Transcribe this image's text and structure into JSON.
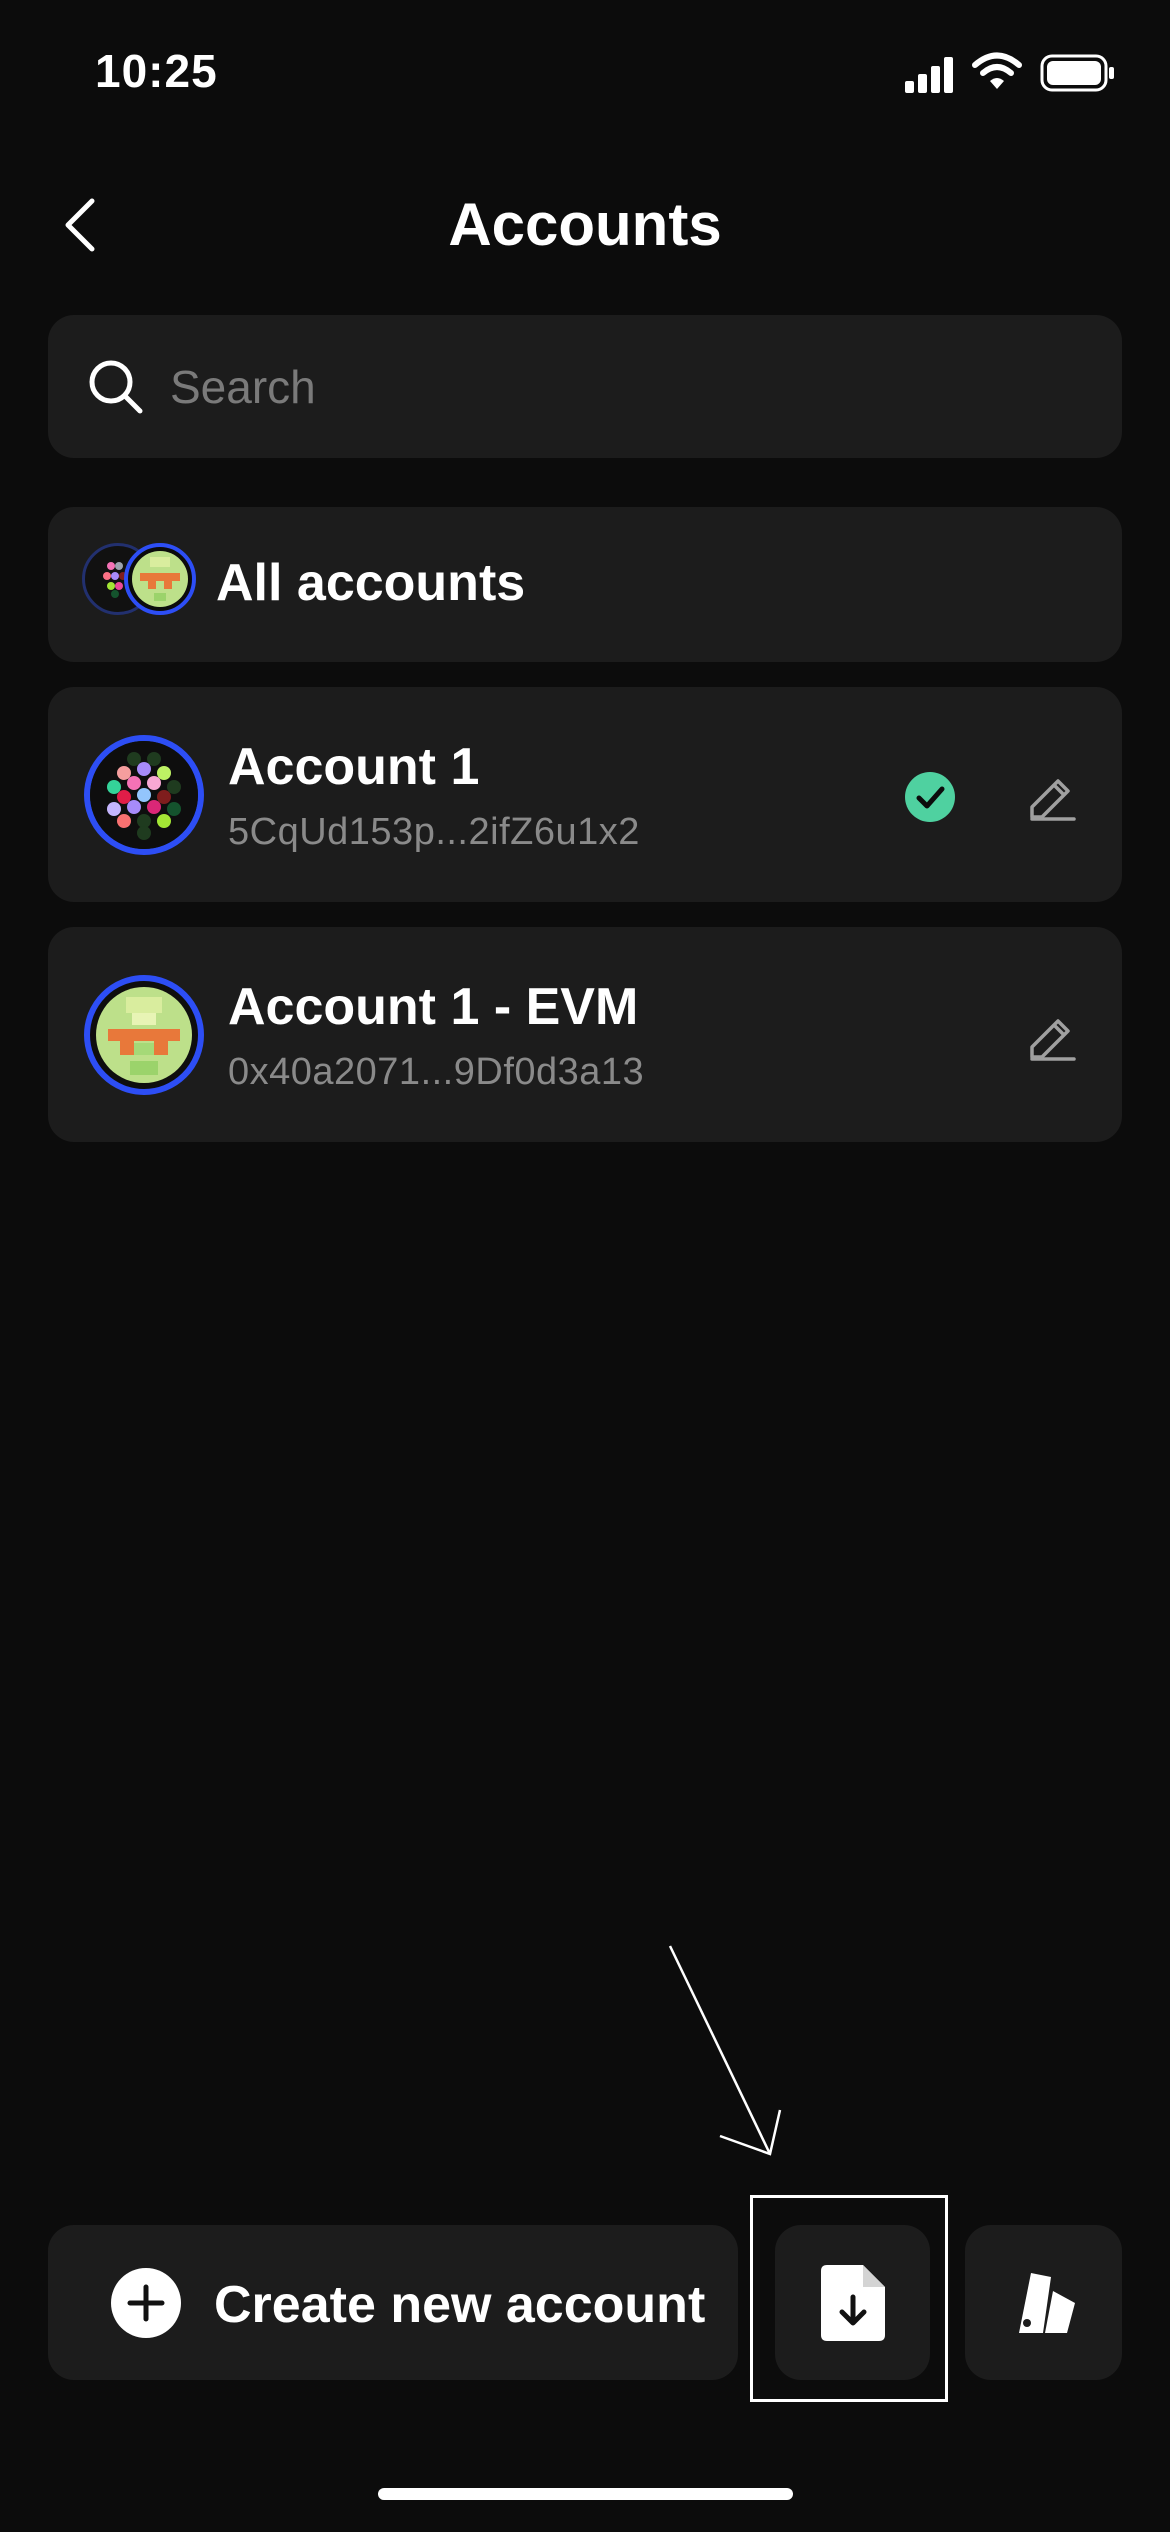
{
  "status_bar": {
    "time": "10:25"
  },
  "header": {
    "title": "Accounts"
  },
  "search": {
    "placeholder": "Search"
  },
  "all_accounts": {
    "label": "All accounts"
  },
  "accounts": [
    {
      "name": "Account 1",
      "address": "5CqUd153p...2ifZ6u1x2",
      "selected": true
    },
    {
      "name": "Account 1 - EVM",
      "address": "0x40a2071...9Df0d3a13",
      "selected": false
    }
  ],
  "footer": {
    "create_label": "Create new account"
  },
  "colors": {
    "accent_ring": "#2d4ef5",
    "check": "#4fd1a0",
    "card": "#1c1c1c"
  }
}
